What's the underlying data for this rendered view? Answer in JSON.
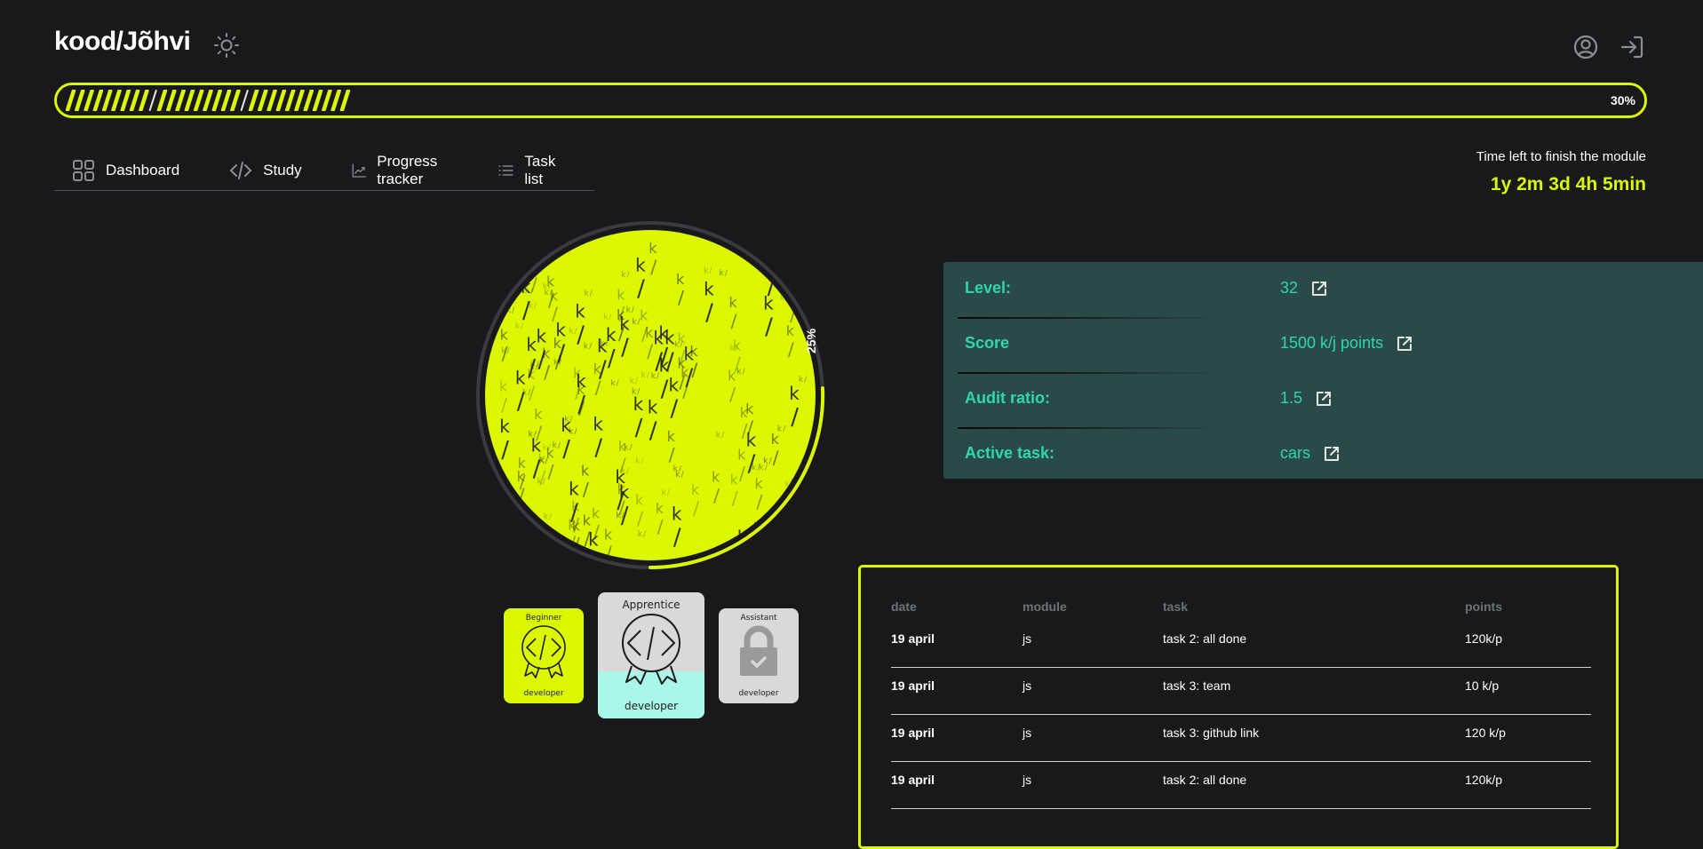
{
  "header": {
    "logo": "kood/Jõhvi",
    "theme_icon": "sun-icon",
    "profile_icon": "user-circle-icon",
    "logout_icon": "logout-icon"
  },
  "progress": {
    "value": 30,
    "label": "30%",
    "accent": "#dcf800"
  },
  "nav": {
    "items": [
      {
        "label": "Dashboard",
        "icon": "grid-icon"
      },
      {
        "label": "Study",
        "icon": "code-icon"
      },
      {
        "label": "Progress tracker",
        "icon": "chart-icon"
      },
      {
        "label": "Task list",
        "icon": "list-icon"
      }
    ]
  },
  "time_left": {
    "label": "Time left to finish the module",
    "value": "1y 2m 3d 4h 5min"
  },
  "circle": {
    "progress": 25,
    "label": "25%"
  },
  "badges": [
    {
      "title": "Beginner",
      "subtitle": "developer",
      "state": "achieved"
    },
    {
      "title": "Apprentice",
      "subtitle": "developer",
      "state": "in-progress"
    },
    {
      "title": "Assistant",
      "subtitle": "developer",
      "state": "locked"
    }
  ],
  "stats": [
    {
      "label": "Level:",
      "value": "32"
    },
    {
      "label": "Score",
      "value": "1500 k/j points"
    },
    {
      "label": "Audit ratio:",
      "value": "1.5"
    },
    {
      "label": "Active task:",
      "value": "cars"
    }
  ],
  "table": {
    "headers": [
      "date",
      "module",
      "task",
      "points"
    ],
    "rows": [
      [
        "19 april",
        "js",
        "task 2: all done",
        "120k/p"
      ],
      [
        "19 april",
        "js",
        "task 3: team",
        "10 k/p"
      ],
      [
        "19 april",
        "js",
        "task 3: github link",
        "120 k/p"
      ],
      [
        "19 april",
        "js",
        "task 2: all done",
        "120k/p"
      ]
    ]
  }
}
